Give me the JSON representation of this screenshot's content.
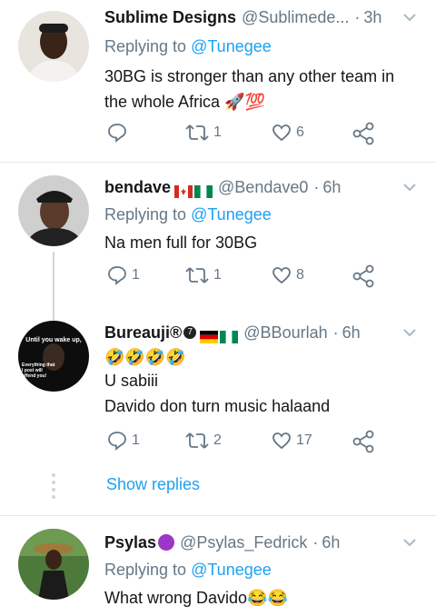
{
  "tweets": [
    {
      "name": "Sublime Designs",
      "handle": "@Sublimede...",
      "time": "3h",
      "replying_prefix": "Replying to",
      "replying_to": "@Tunegee",
      "text_lines": [
        "30BG is stronger than any other team in",
        "the whole Africa 🚀💯"
      ],
      "replies": "",
      "retweets": "1",
      "likes": "6"
    },
    {
      "name": "bendave",
      "handle": "@Bendave0",
      "time": "6h",
      "replying_prefix": "Replying to",
      "replying_to": "@Tunegee",
      "text_lines": [
        "Na men full for 30BG"
      ],
      "replies": "1",
      "retweets": "1",
      "likes": "8"
    },
    {
      "name": "Bureauji®",
      "handle": "@BBourlah",
      "time": "6h",
      "emoji_line": "🤣🤣🤣🤣",
      "text_lines": [
        "U sabiii",
        "Davido don turn music halaand"
      ],
      "replies": "1",
      "retweets": "2",
      "likes": "17",
      "avatar_text_top": "Until you wake up,",
      "avatar_text_bottom": "Everything that I post will offend you!"
    },
    {
      "name": "Psylas",
      "handle": "@Psylas_Fedrick",
      "time": "6h",
      "replying_prefix": "Replying to",
      "replying_to": "@Tunegee",
      "text_lines": [
        "What wrong Davido😂😂"
      ]
    }
  ],
  "show_replies": "Show replies",
  "separator_dot": "·",
  "icons": {
    "reply": "reply-icon",
    "retweet": "retweet-icon",
    "like": "heart-icon",
    "share": "share-icon",
    "menu": "chevron-down-icon"
  },
  "colors": {
    "link": "#1da1f2",
    "secondary": "#657786",
    "divider": "#e1e8ed"
  }
}
